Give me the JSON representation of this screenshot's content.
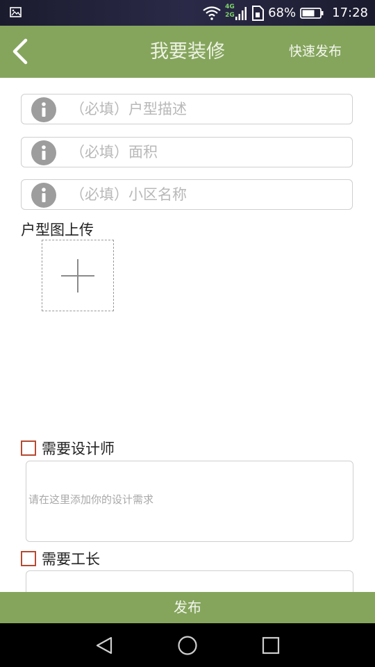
{
  "status_bar": {
    "network_type_top": "4G",
    "network_type_bottom": "2G",
    "battery_percent": "68%",
    "time": "17:28",
    "icons": [
      "gallery-notification-icon",
      "wifi-icon",
      "signal-icon",
      "sim-icon",
      "battery-icon"
    ]
  },
  "header": {
    "title": "我要装修",
    "quick_publish_label": "快速发布",
    "background_color": "#85a55d"
  },
  "form": {
    "house_type_placeholder": "（必填）户型描述",
    "area_placeholder": "（必填）面积",
    "community_placeholder": "（必填）小区名称",
    "floor_plan_label": "户型图上传",
    "need_designer": {
      "label": "需要设计师",
      "checked": false,
      "textarea_placeholder": "请在这里添加你的设计需求"
    },
    "need_foreman": {
      "label": "需要工长",
      "checked": false
    }
  },
  "footer": {
    "publish_label": "发布"
  },
  "colors": {
    "accent": "#85a55d",
    "checkbox_border": "#b54a32",
    "info_icon": "#9d9d9d"
  }
}
